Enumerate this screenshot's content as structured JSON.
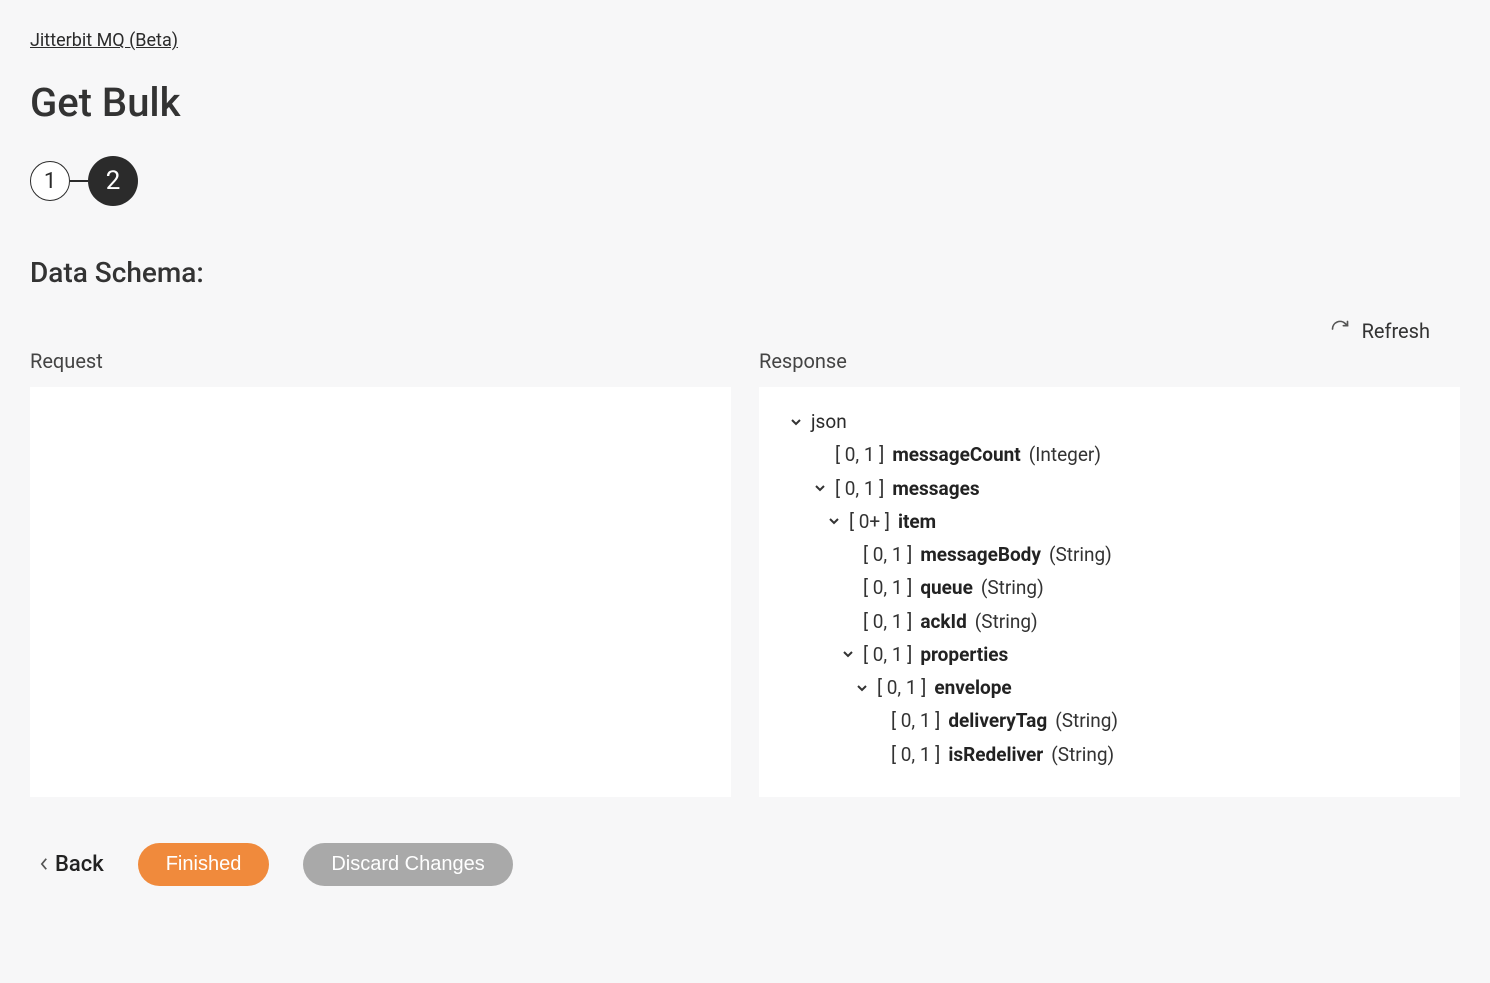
{
  "breadcrumb": "Jitterbit MQ (Beta)",
  "title": "Get Bulk",
  "stepper": {
    "step1": "1",
    "step2": "2"
  },
  "section_title": "Data Schema:",
  "refresh_label": "Refresh",
  "request_label": "Request",
  "response_label": "Response",
  "schema": {
    "root": "json",
    "n1": {
      "card": "[ 0, 1 ]",
      "name": "messageCount",
      "type": "(Integer)"
    },
    "n2": {
      "card": "[ 0, 1 ]",
      "name": "messages"
    },
    "n3": {
      "card": "[ 0+ ]",
      "name": "item"
    },
    "n4": {
      "card": "[ 0, 1 ]",
      "name": "messageBody",
      "type": "(String)"
    },
    "n5": {
      "card": "[ 0, 1 ]",
      "name": "queue",
      "type": "(String)"
    },
    "n6": {
      "card": "[ 0, 1 ]",
      "name": "ackId",
      "type": "(String)"
    },
    "n7": {
      "card": "[ 0, 1 ]",
      "name": "properties"
    },
    "n8": {
      "card": "[ 0, 1 ]",
      "name": "envelope"
    },
    "n9": {
      "card": "[ 0, 1 ]",
      "name": "deliveryTag",
      "type": "(String)"
    },
    "n10": {
      "card": "[ 0, 1 ]",
      "name": "isRedeliver",
      "type": "(String)"
    }
  },
  "footer": {
    "back": "Back",
    "finished": "Finished",
    "discard": "Discard Changes"
  }
}
